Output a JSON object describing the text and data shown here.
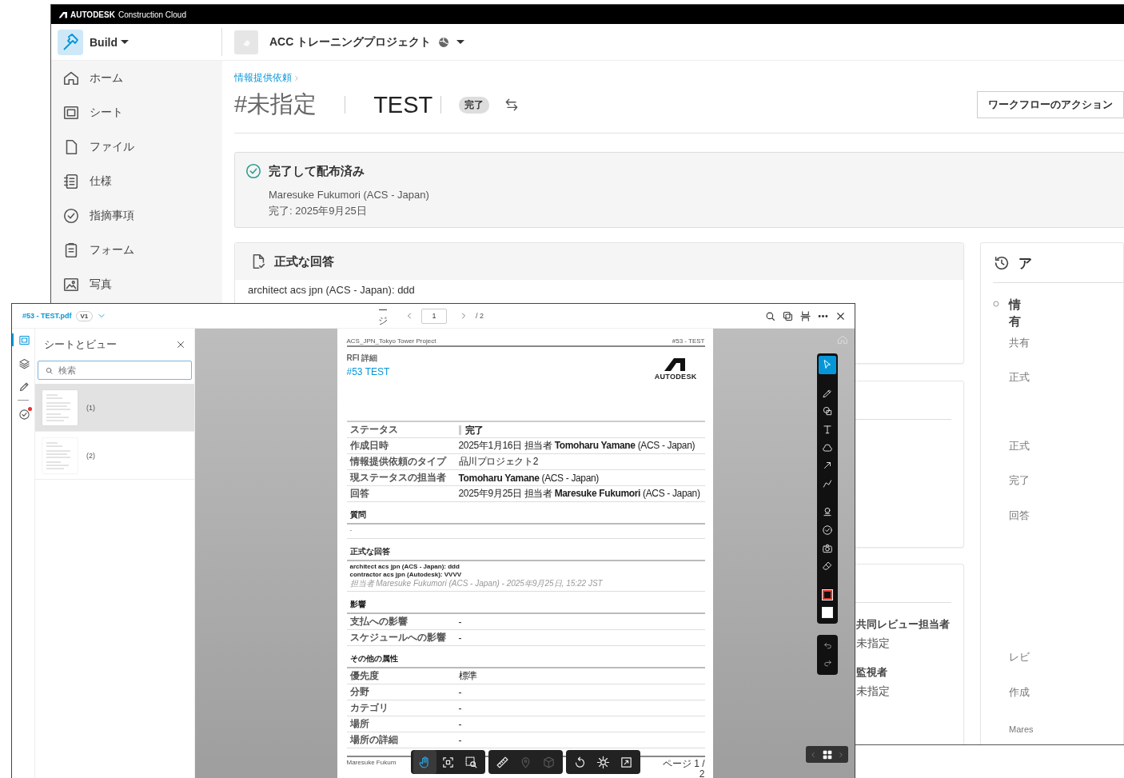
{
  "app_bar": {
    "brand": "AUTODESK",
    "product": "Construction Cloud"
  },
  "module_switcher": {
    "label": "Build"
  },
  "project": {
    "name": "ACC トレーニングプロジェクト"
  },
  "sidebar": {
    "items": [
      {
        "label": "ホーム"
      },
      {
        "label": "シート"
      },
      {
        "label": "ファイル"
      },
      {
        "label": "仕様"
      },
      {
        "label": "指摘事項"
      },
      {
        "label": "フォーム"
      },
      {
        "label": "写真"
      }
    ]
  },
  "breadcrumb": [
    {
      "label": "情報提供依頼"
    }
  ],
  "rfi": {
    "number": "#未指定",
    "title": "TEST",
    "status": "完了",
    "workflow_button": "ワークフローのアクション"
  },
  "status_card": {
    "title": "完了して配布済み",
    "person": "Maresuke Fukumori (ACS - Japan)",
    "date": "完了: 2025年9月25日"
  },
  "response_card": {
    "title": "正式な回答",
    "text": "architect acs jpn (ACS - Japan): ddd"
  },
  "people_card": {
    "fields": [
      {
        "label": "共同レビュー担当者",
        "value": "未指定"
      },
      {
        "label": "監視者",
        "value": "未指定"
      }
    ]
  },
  "activity": {
    "title": "ア",
    "entries": [
      {
        "title_lines": [
          "情",
          "有"
        ],
        "detail": "共有"
      }
    ],
    "fields": [
      "正式",
      "正式",
      "完了",
      "回答",
      "レビ",
      "作成"
    ],
    "footer": "Mares"
  },
  "viewer": {
    "file_name": "#53 - TEST.pdf",
    "version": "V1",
    "page_label": "ージ",
    "page_input": "1",
    "page_count": "/ 2",
    "rail": [
      {
        "selected": true,
        "notification": false
      },
      {
        "selected": false,
        "notification": false
      },
      {
        "selected": false,
        "notification": false
      },
      {
        "selected": false,
        "notification": true
      }
    ],
    "panel": {
      "title": "シートとビュー",
      "search": {
        "placeholder": "検索"
      },
      "sheets": [
        {
          "label": "(1)",
          "selected": true
        },
        {
          "label": "(2)",
          "selected": false
        }
      ]
    },
    "markup_tools": [
      {
        "selected": true
      },
      {
        "selected": false
      },
      {
        "selected": false
      },
      {
        "selected": false
      },
      {
        "selected": false
      },
      {
        "selected": false
      },
      {
        "selected": false
      },
      {
        "selected": false
      },
      {
        "selected": false
      },
      {
        "selected": false
      },
      {
        "selected": false
      }
    ],
    "swatches": [
      {
        "color": "#e5332a"
      },
      {
        "color": "#ffffff"
      }
    ],
    "nav_tools": [
      {
        "selected": true,
        "disabled": false
      },
      {
        "selected": false,
        "disabled": false
      },
      {
        "selected": false,
        "disabled": false
      },
      {
        "selected": false,
        "disabled": false
      },
      {
        "selected": false,
        "disabled": true
      },
      {
        "selected": false,
        "disabled": true
      },
      {
        "selected": false,
        "disabled": false
      },
      {
        "selected": false,
        "disabled": false
      },
      {
        "selected": false,
        "disabled": false
      }
    ],
    "document": {
      "project": "ACS_JPN_Tokyo Tower Project",
      "ref": "#53 - TEST",
      "kicker": "RFI 詳細",
      "title": "#53 TEST",
      "logo_text": "AUTODESK",
      "details": [
        {
          "label": "ステータス",
          "value": "完了",
          "kind": "status"
        },
        {
          "label": "作成日時",
          "value": "2025年1月16日 担当者 **Tomoharu Yamane** (ACS - Japan)",
          "kind": "text"
        },
        {
          "label": "情報提供依頼のタイプ",
          "value": "品川プロジェクト2",
          "kind": "text"
        },
        {
          "label": "現ステータスの担当者",
          "value": "**Tomoharu Yamane** (ACS - Japan)",
          "kind": "text"
        },
        {
          "label": "回答",
          "value": "2025年9月25日 担当者 **Maresuke Fukumori** (ACS - Japan)",
          "kind": "text"
        }
      ],
      "sections": [
        {
          "title": "質問",
          "kind": "text",
          "lines": [
            "-"
          ]
        },
        {
          "title": "正式な回答",
          "kind": "response",
          "lines": [
            "architect acs jpn (ACS - Japan): ddd",
            "contractor acs jpn (Autodesk): VVVV"
          ],
          "meta": "担当者 Maresuke Fukumori (ACS - Japan) - 2025年9月25日, 15:22 JST"
        },
        {
          "title": "影響",
          "kind": "table",
          "rows": [
            {
              "label": "支払への影響",
              "value": "-"
            },
            {
              "label": "スケジュールへの影響",
              "value": "-"
            }
          ]
        },
        {
          "title": "その他の属性",
          "kind": "table",
          "rows": [
            {
              "label": "優先度",
              "value": "標準"
            },
            {
              "label": "分野",
              "value": "-"
            },
            {
              "label": "カテゴリ",
              "value": "-"
            },
            {
              "label": "場所",
              "value": "-"
            },
            {
              "label": "場所の詳細",
              "value": "-"
            }
          ]
        }
      ],
      "footer": {
        "left": "Maresuke Fukum",
        "right": "ページ 1 / 2"
      }
    }
  }
}
